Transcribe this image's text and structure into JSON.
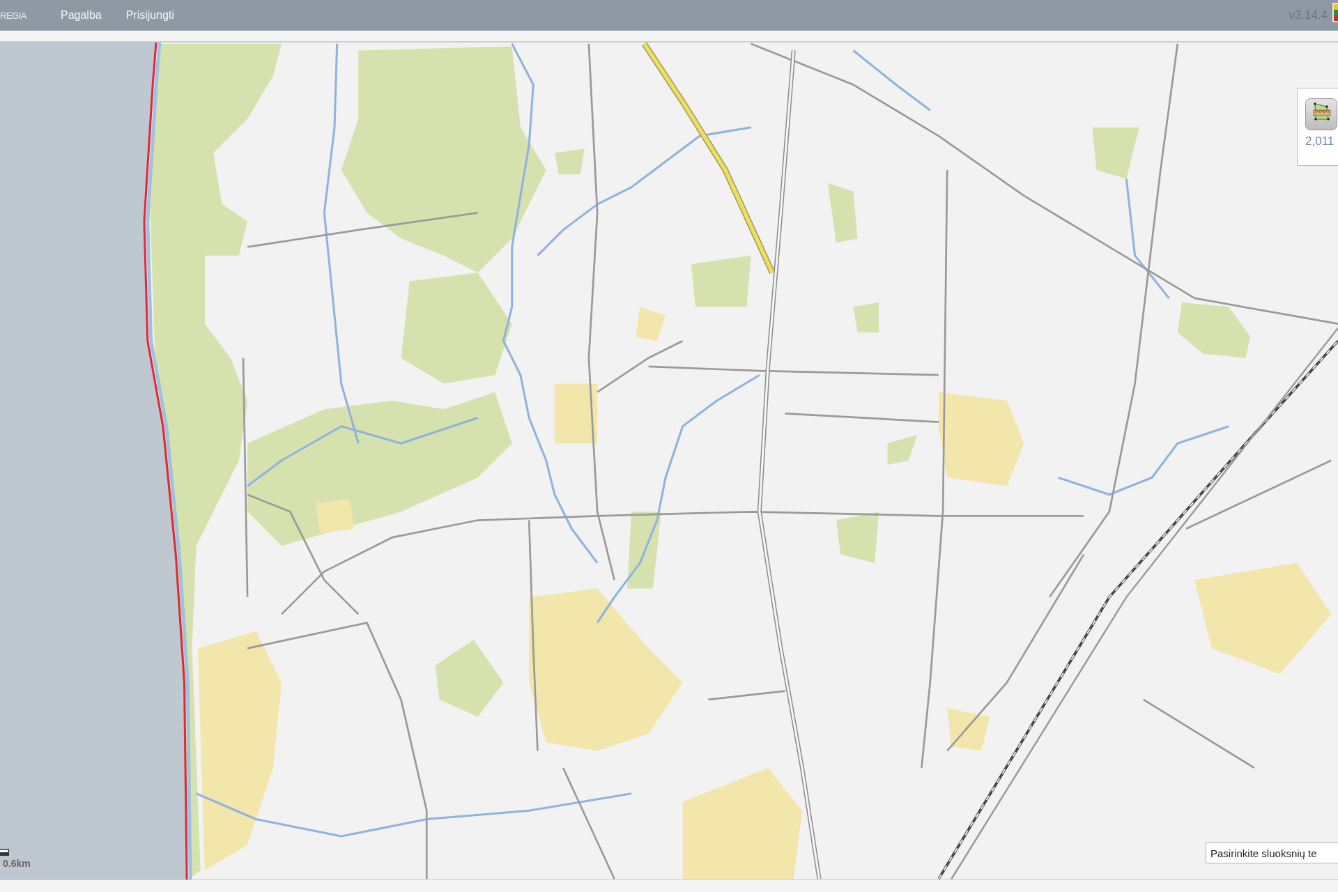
{
  "header": {
    "brand": "REGIA",
    "menu": [
      {
        "label": "Pagalba"
      },
      {
        "label": "Prisijungti"
      }
    ],
    "version": "v3.14.4"
  },
  "map": {
    "measure_panel": {
      "reading": "2,011"
    },
    "scale": {
      "label": "0.6km"
    },
    "layer_select": {
      "value": "Pasirinkite sluoksnių te"
    }
  }
}
